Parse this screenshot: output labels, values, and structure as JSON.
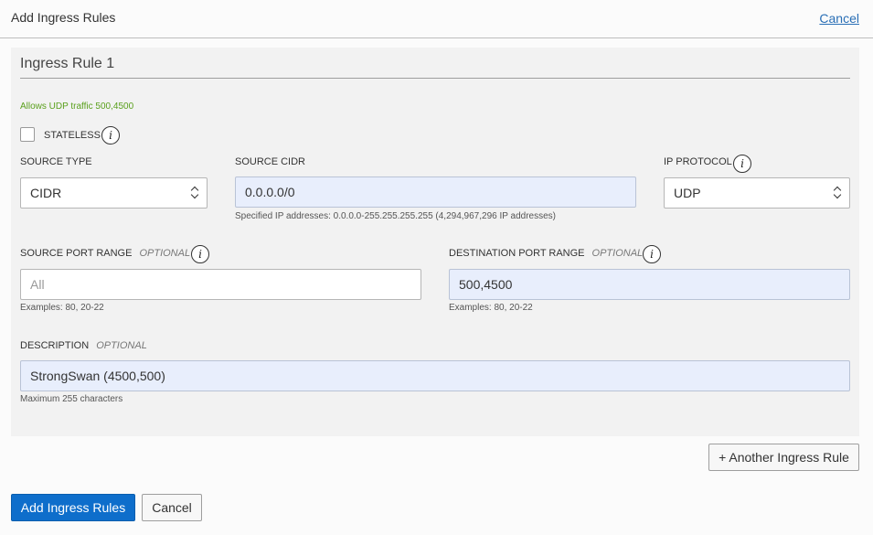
{
  "header": {
    "title": "Add Ingress Rules",
    "cancel_link": "Cancel"
  },
  "rule": {
    "title": "Ingress Rule 1",
    "summary": "Allows UDP traffic 500,4500",
    "stateless": {
      "label": "STATELESS",
      "checked": false
    },
    "source_type": {
      "label": "SOURCE TYPE",
      "value": "CIDR"
    },
    "source_cidr": {
      "label": "SOURCE CIDR",
      "value": "0.0.0.0/0",
      "hint": "Specified IP addresses: 0.0.0.0-255.255.255.255 (4,294,967,296 IP addresses)"
    },
    "ip_protocol": {
      "label": "IP PROTOCOL",
      "value": "UDP"
    },
    "source_port_range": {
      "label": "SOURCE PORT RANGE",
      "optional": "OPTIONAL",
      "placeholder": "All",
      "hint": "Examples: 80, 20-22"
    },
    "destination_port_range": {
      "label": "DESTINATION PORT RANGE",
      "optional": "OPTIONAL",
      "value": "500,4500",
      "hint": "Examples: 80, 20-22"
    },
    "description": {
      "label": "DESCRIPTION",
      "optional": "OPTIONAL",
      "value": "StrongSwan (4500,500)",
      "hint": "Maximum 255 characters"
    }
  },
  "another_rule_button": "+ Another Ingress Rule",
  "footer": {
    "submit_label": "Add Ingress Rules",
    "cancel_label": "Cancel"
  },
  "colors": {
    "accent": "#0e6ecb",
    "summary_green": "#5aa01d",
    "filled_field": "#e8eefc",
    "link": "#2a6fb6"
  }
}
